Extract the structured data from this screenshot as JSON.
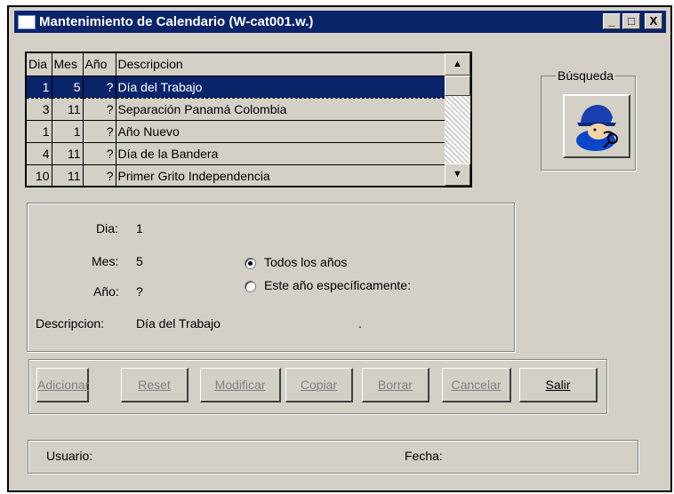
{
  "window": {
    "title": "Mantenimiento de Calendario (W-cat001.w.)",
    "controls": {
      "minimize": "_",
      "maximize": "□",
      "close": "X"
    }
  },
  "grid": {
    "columns": [
      "Dia",
      "Mes",
      "Año",
      "Descripcion"
    ],
    "rows": [
      {
        "dia": "1",
        "mes": "5",
        "anio": "?",
        "descripcion": "Día del Trabajo",
        "selected": true
      },
      {
        "dia": "3",
        "mes": "11",
        "anio": "?",
        "descripcion": "Separación Panamá Colombia"
      },
      {
        "dia": "1",
        "mes": "1",
        "anio": "?",
        "descripcion": "Año Nuevo"
      },
      {
        "dia": "4",
        "mes": "11",
        "anio": "?",
        "descripcion": "Día de la Bandera"
      },
      {
        "dia": "10",
        "mes": "11",
        "anio": "?",
        "descripcion": "Primer Grito Independencia"
      }
    ]
  },
  "busqueda": {
    "label": "Búsqueda",
    "icon": "search-detective-icon"
  },
  "detail": {
    "dia_label": "Dia:",
    "dia_value": "1",
    "mes_label": "Mes:",
    "mes_value": "5",
    "anio_label": "Año:",
    "anio_value": "?",
    "descripcion_label": "Descripcion:",
    "descripcion_value": "Día del Trabajo",
    "dot": ".",
    "radio_todos": "Todos los años",
    "radio_especifico": "Este año específicamente:",
    "radio_selected": "todos"
  },
  "buttons": {
    "adicionar": "Adicionar",
    "reset": "Reset",
    "modificar": "Modificar",
    "copiar": "Copiar",
    "borrar": "Borrar",
    "cancelar": "Cancelar",
    "salir": "Salir"
  },
  "status": {
    "usuario_label": "Usuario:",
    "fecha_label": "Fecha:"
  },
  "colors": {
    "titlebar": "#0a246a",
    "face": "#d4d0c8",
    "selection": "#0a246a"
  }
}
